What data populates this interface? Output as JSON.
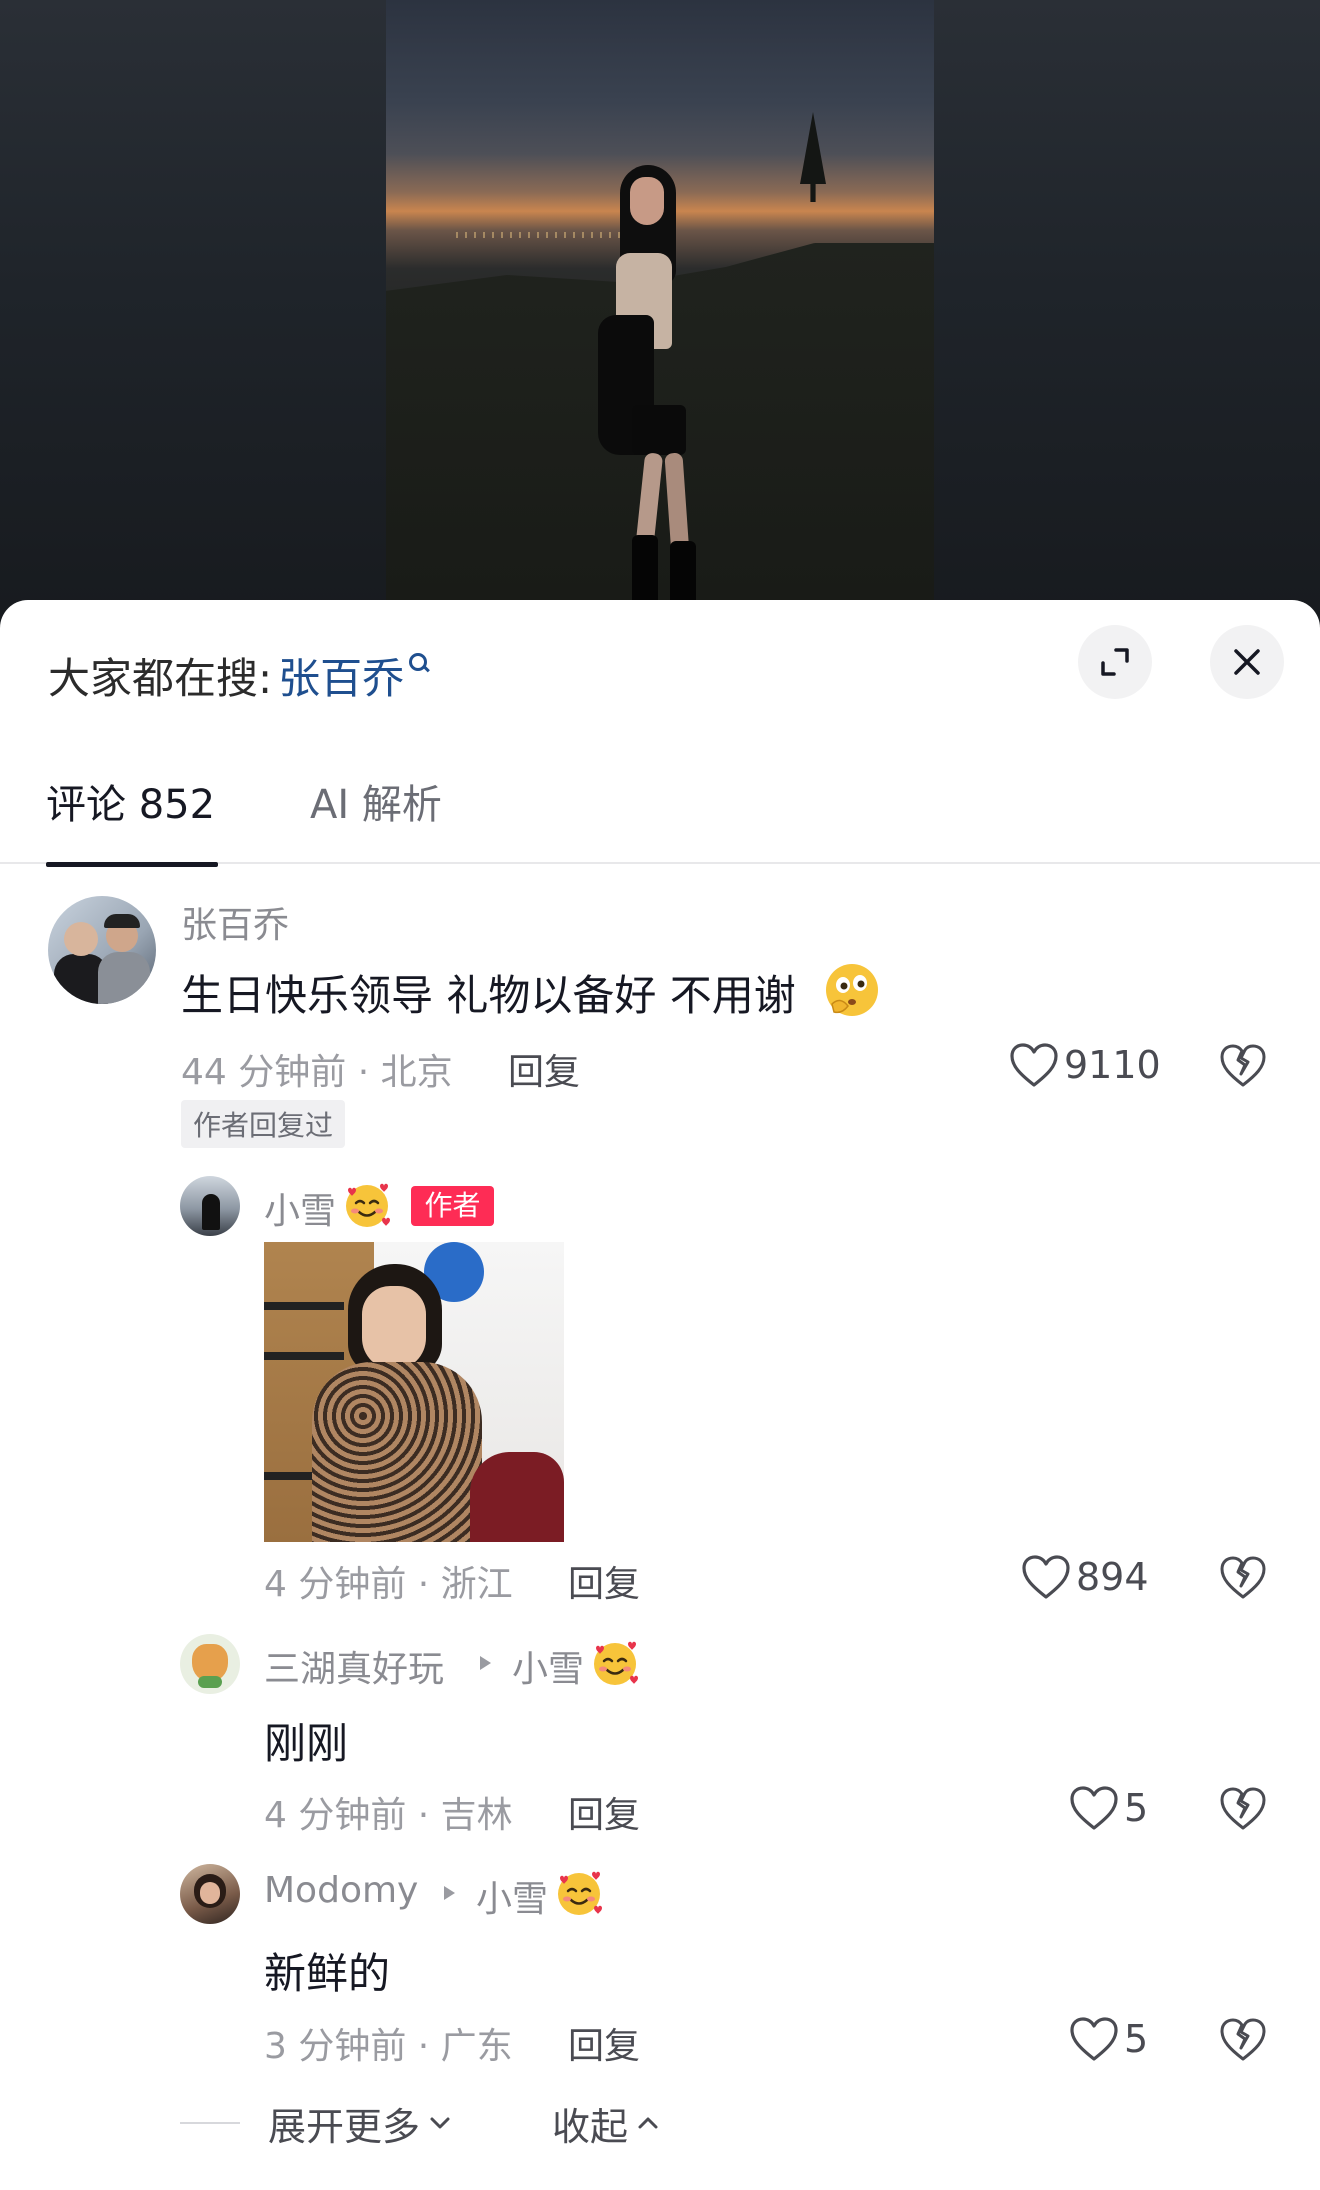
{
  "search": {
    "prefix": "大家都在搜:",
    "term": "张百乔"
  },
  "tabs": [
    {
      "label": "评论 852",
      "active": true
    },
    {
      "label": "AI 解析",
      "active": false
    }
  ],
  "comments": [
    {
      "username": "张百乔",
      "text": "生日快乐领导 礼物以备好 不用谢",
      "emoji": "thinking-face-emoji",
      "meta": "44 分钟前 · 北京",
      "reply_label": "回复",
      "likes": "9110",
      "badge": "作者回复过"
    }
  ],
  "replies": [
    {
      "username": "小雪",
      "emoji": "smiling-face-with-hearts",
      "author_badge": "作者",
      "meta": "4 分钟前 · 浙江",
      "reply_label": "回复",
      "likes": "894"
    },
    {
      "username": "三湖真好玩",
      "reply_to": "小雪",
      "text": "刚刚",
      "meta": "4 分钟前 · 吉林",
      "reply_label": "回复",
      "likes": "5"
    },
    {
      "username": "Modomy",
      "reply_to": "小雪",
      "text": "新鲜的",
      "meta": "3 分钟前 · 广东",
      "reply_label": "回复",
      "likes": "5"
    }
  ],
  "expand": {
    "more_label": "展开更多",
    "collapse_label": "收起"
  },
  "colors": {
    "accent_link": "#1f4f8f",
    "author_badge": "#fe2c55",
    "text_primary": "#161823",
    "text_secondary": "#8a8b91"
  }
}
